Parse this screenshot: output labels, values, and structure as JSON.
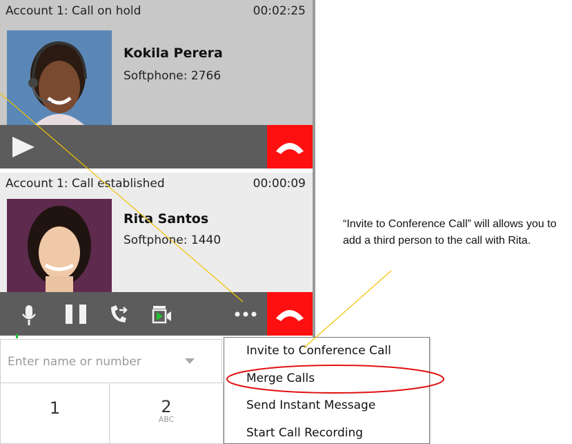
{
  "call1": {
    "status": "Account 1: Call on hold",
    "timer": "00:02:25",
    "name": "Kokila Perera",
    "number": "Softphone: 2766"
  },
  "call2": {
    "status": "Account 1: Call established",
    "timer": "00:00:09",
    "name": "Rita Santos",
    "number": "Softphone: 1440"
  },
  "dialpad": {
    "placeholder": "Enter name or number",
    "keys": [
      {
        "digit": "1",
        "letters": ""
      },
      {
        "digit": "2",
        "letters": "ABC"
      }
    ]
  },
  "menu": {
    "items": [
      "Invite to Conference Call",
      "Merge Calls",
      "Send Instant Message",
      "Start Call Recording"
    ]
  },
  "annotation": {
    "text": "“Invite to Conference Call” will allows you to add a third person to the call with Rita."
  },
  "colors": {
    "hangup": "#ff1010",
    "control_bar": "#5c5c5c",
    "card_bg": "#c8c8c8",
    "highlight_ellipse": "#e01010",
    "callout_line": "#f2c200"
  }
}
